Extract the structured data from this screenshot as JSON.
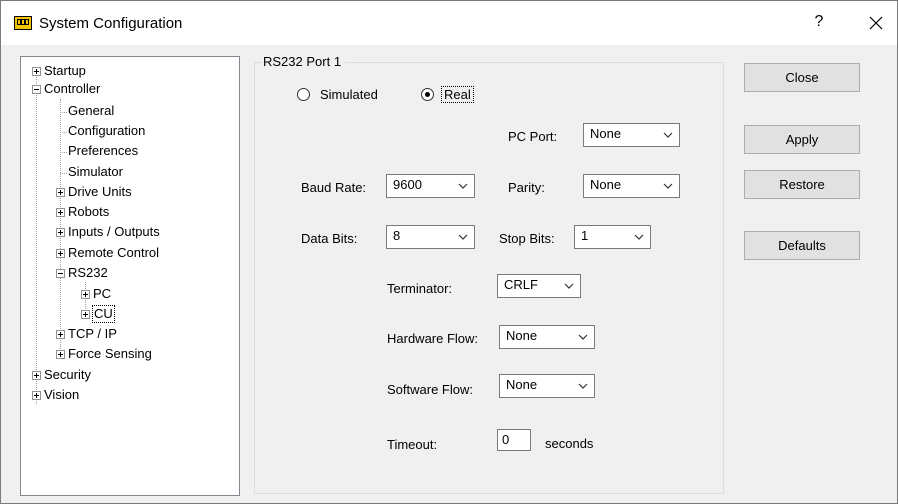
{
  "window": {
    "title": "System Configuration",
    "help_label": "?"
  },
  "tree": {
    "items": [
      {
        "label": "Startup"
      },
      {
        "label": "Controller"
      },
      {
        "label": "General"
      },
      {
        "label": "Configuration"
      },
      {
        "label": "Preferences"
      },
      {
        "label": "Simulator"
      },
      {
        "label": "Drive Units"
      },
      {
        "label": "Robots"
      },
      {
        "label": "Inputs / Outputs"
      },
      {
        "label": "Remote Control"
      },
      {
        "label": "RS232"
      },
      {
        "label": "PC"
      },
      {
        "label": "CU"
      },
      {
        "label": "TCP / IP"
      },
      {
        "label": "Force Sensing"
      },
      {
        "label": "Security"
      },
      {
        "label": "Vision"
      }
    ]
  },
  "group": {
    "title": "RS232 Port 1",
    "mode_simulated": "Simulated",
    "mode_real": "Real",
    "pc_port_label": "PC Port:",
    "pc_port_value": "None",
    "baud_rate_label": "Baud Rate:",
    "baud_rate_value": "9600",
    "parity_label": "Parity:",
    "parity_value": "None",
    "data_bits_label": "Data Bits:",
    "data_bits_value": "8",
    "stop_bits_label": "Stop Bits:",
    "stop_bits_value": "1",
    "terminator_label": "Terminator:",
    "terminator_value": "CRLF",
    "hardware_flow_label": "Hardware Flow:",
    "hardware_flow_value": "None",
    "software_flow_label": "Software Flow:",
    "software_flow_value": "None",
    "timeout_label": "Timeout:",
    "timeout_value": "0",
    "timeout_unit": "seconds"
  },
  "buttons": {
    "close": "Close",
    "apply": "Apply",
    "restore": "Restore",
    "defaults": "Defaults"
  }
}
